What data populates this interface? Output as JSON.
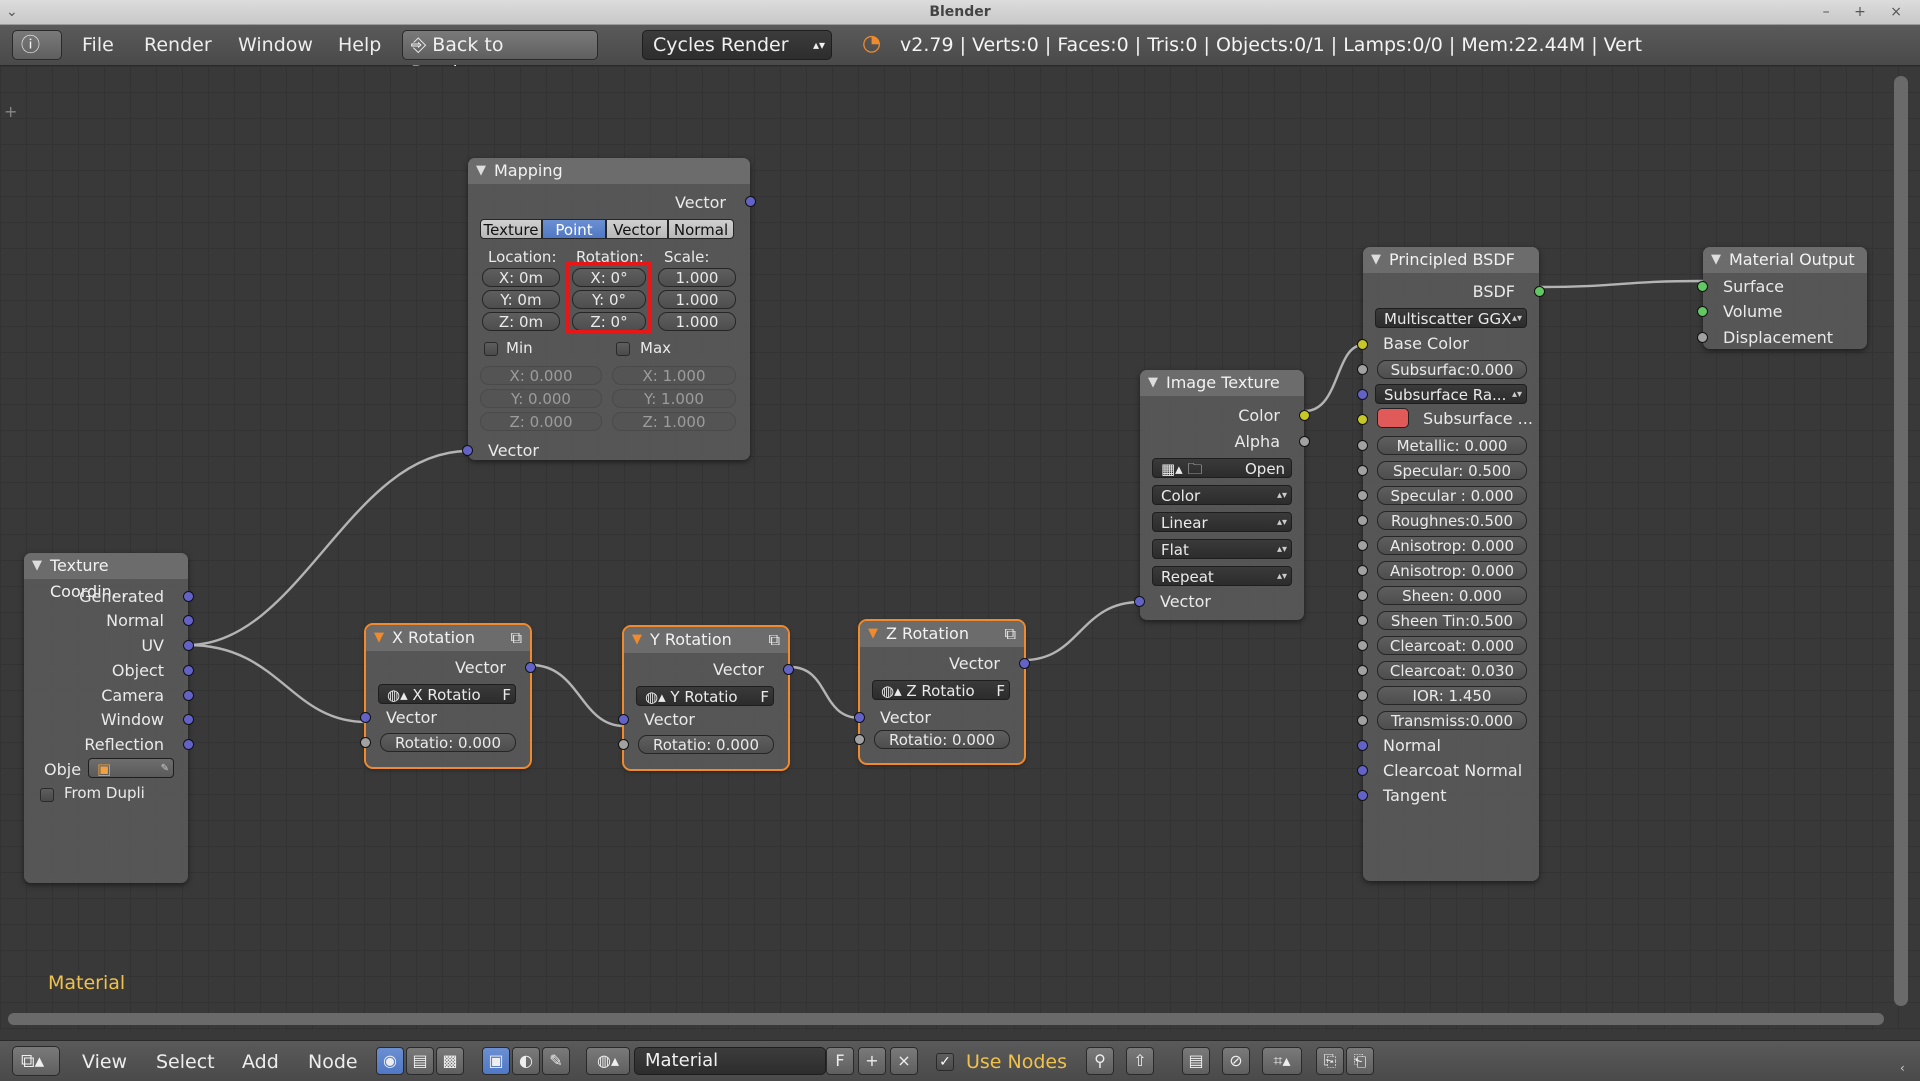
{
  "window": {
    "title": "Blender"
  },
  "menu": {
    "file": "File",
    "render": "Render",
    "window": "Window",
    "help": "Help",
    "back": "Back to Previous",
    "engine": "Cycles Render"
  },
  "stats": "v2.79 | Verts:0 | Faces:0 | Tris:0 | Objects:0/1 | Lamps:0/0 | Mem:22.44M | Vert",
  "mapping": {
    "title": "Mapping",
    "out": "Vector",
    "tabs": [
      "Texture",
      "Point",
      "Vector",
      "Normal"
    ],
    "active_tab": "Point",
    "loc_label": "Location:",
    "rot_label": "Rotation:",
    "scale_label": "Scale:",
    "loc": [
      "X: 0m",
      "Y: 0m",
      "Z: 0m"
    ],
    "rot": [
      "X:   0°",
      "Y:   0°",
      "Z:   0°"
    ],
    "scale": [
      "1.000",
      "1.000",
      "1.000"
    ],
    "min_label": "Min",
    "max_label": "Max",
    "min": [
      "X:        0.000",
      "Y:        0.000",
      "Z:        0.000"
    ],
    "max": [
      "X:        1.000",
      "Y:        1.000",
      "Z:        1.000"
    ],
    "in": "Vector"
  },
  "texcoord": {
    "title": "Texture Coordin...",
    "outputs": [
      "Generated",
      "Normal",
      "UV",
      "Object",
      "Camera",
      "Window",
      "Reflection"
    ],
    "obj_label": "Obje",
    "dupli": "From Dupli"
  },
  "xrot": {
    "title": "X Rotation",
    "out": "Vector",
    "grp": "X Rotatio",
    "f": "F",
    "in": "Vector",
    "rot": "Rotatio:  0.000"
  },
  "yrot": {
    "title": "Y Rotation",
    "out": "Vector",
    "grp": "Y Rotatio",
    "f": "F",
    "in": "Vector",
    "rot": "Rotatio: 0.000"
  },
  "zrot": {
    "title": "Z Rotation",
    "out": "Vector",
    "grp": "Z Rotatio",
    "f": "F",
    "in": "Vector",
    "rot": "Rotatio: 0.000"
  },
  "imgtex": {
    "title": "Image Texture",
    "color": "Color",
    "alpha": "Alpha",
    "open": "Open",
    "colorspace": "Color",
    "interp": "Linear",
    "proj": "Flat",
    "ext": "Repeat",
    "in": "Vector"
  },
  "bsdf": {
    "title": "Principled BSDF",
    "out": "BSDF",
    "dist": "Multiscatter GGX",
    "base": "Base Color",
    "subsurf": "Subsurfac:0.000",
    "subsurf_radius": "Subsurface Ra...",
    "subsurf_color": "Subsurface ...",
    "subsurf_color_hex": "#e05a5a",
    "fields": [
      "Metallic:      0.000",
      "Specular:     0.500",
      "Specular :    0.000",
      "Roughnes:0.500",
      "Anisotrop: 0.000",
      "Anisotrop: 0.000",
      "Sheen:         0.000",
      "Sheen Tin:0.500",
      "Clearcoat: 0.000",
      "Clearcoat: 0.030",
      "IOR:           1.450",
      "Transmiss:0.000"
    ],
    "normal": "Normal",
    "cc_normal": "Clearcoat Normal",
    "tangent": "Tangent"
  },
  "matout": {
    "title": "Material Output",
    "surface": "Surface",
    "volume": "Volume",
    "disp": "Displacement"
  },
  "editor_label": "Material",
  "bottom": {
    "view": "View",
    "select": "Select",
    "add": "Add",
    "node": "Node",
    "material": "Material",
    "f": "F",
    "use_nodes": "Use Nodes"
  }
}
